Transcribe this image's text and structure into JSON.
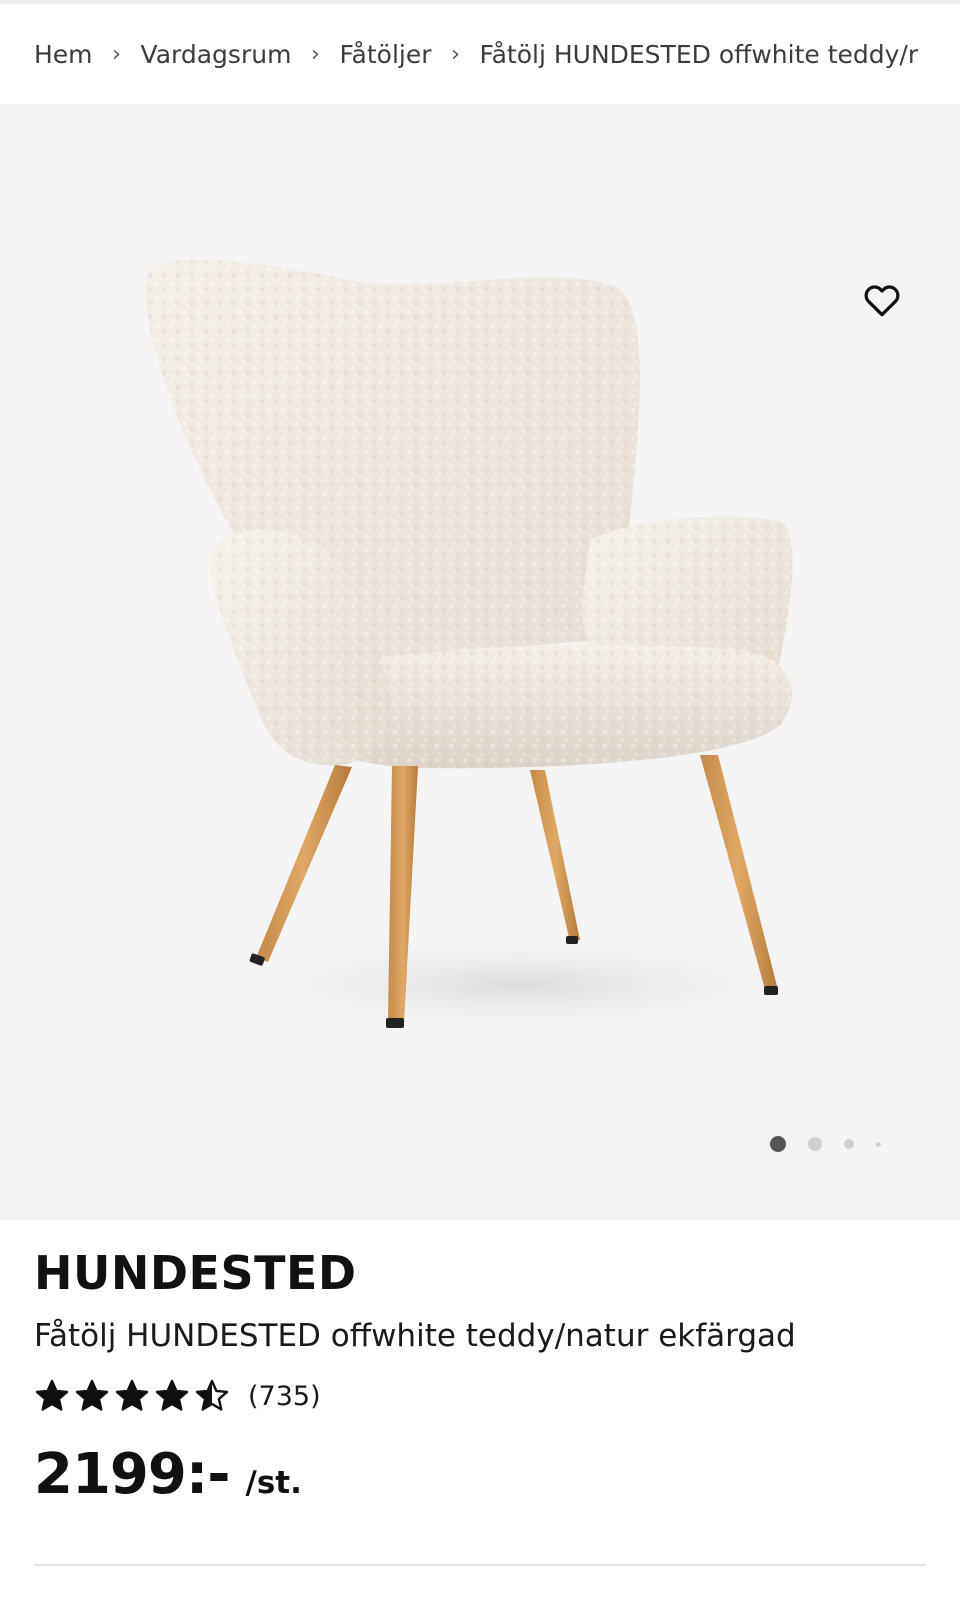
{
  "breadcrumb": {
    "items": [
      "Hem",
      "Vardagsrum",
      "Fåtöljer",
      "Fåtölj HUNDESTED offwhite teddy/r"
    ],
    "separator": "›"
  },
  "gallery": {
    "background": "#f4f4f4",
    "slide_count": 4,
    "active_slide": 1,
    "favorite_icon": "heart-outline-icon"
  },
  "product": {
    "brand": "HUNDESTED",
    "description": "Fåtölj HUNDESTED offwhite teddy/natur ekfärgad",
    "rating_value": 4.5,
    "rating_max": 5,
    "review_count": "(735)",
    "price": "2199:-",
    "unit": "/st."
  },
  "colors": {
    "text": "#1a1a1a",
    "star": "#111111",
    "dot_active": "#555555",
    "dot_inactive": "#d0d0d0"
  }
}
